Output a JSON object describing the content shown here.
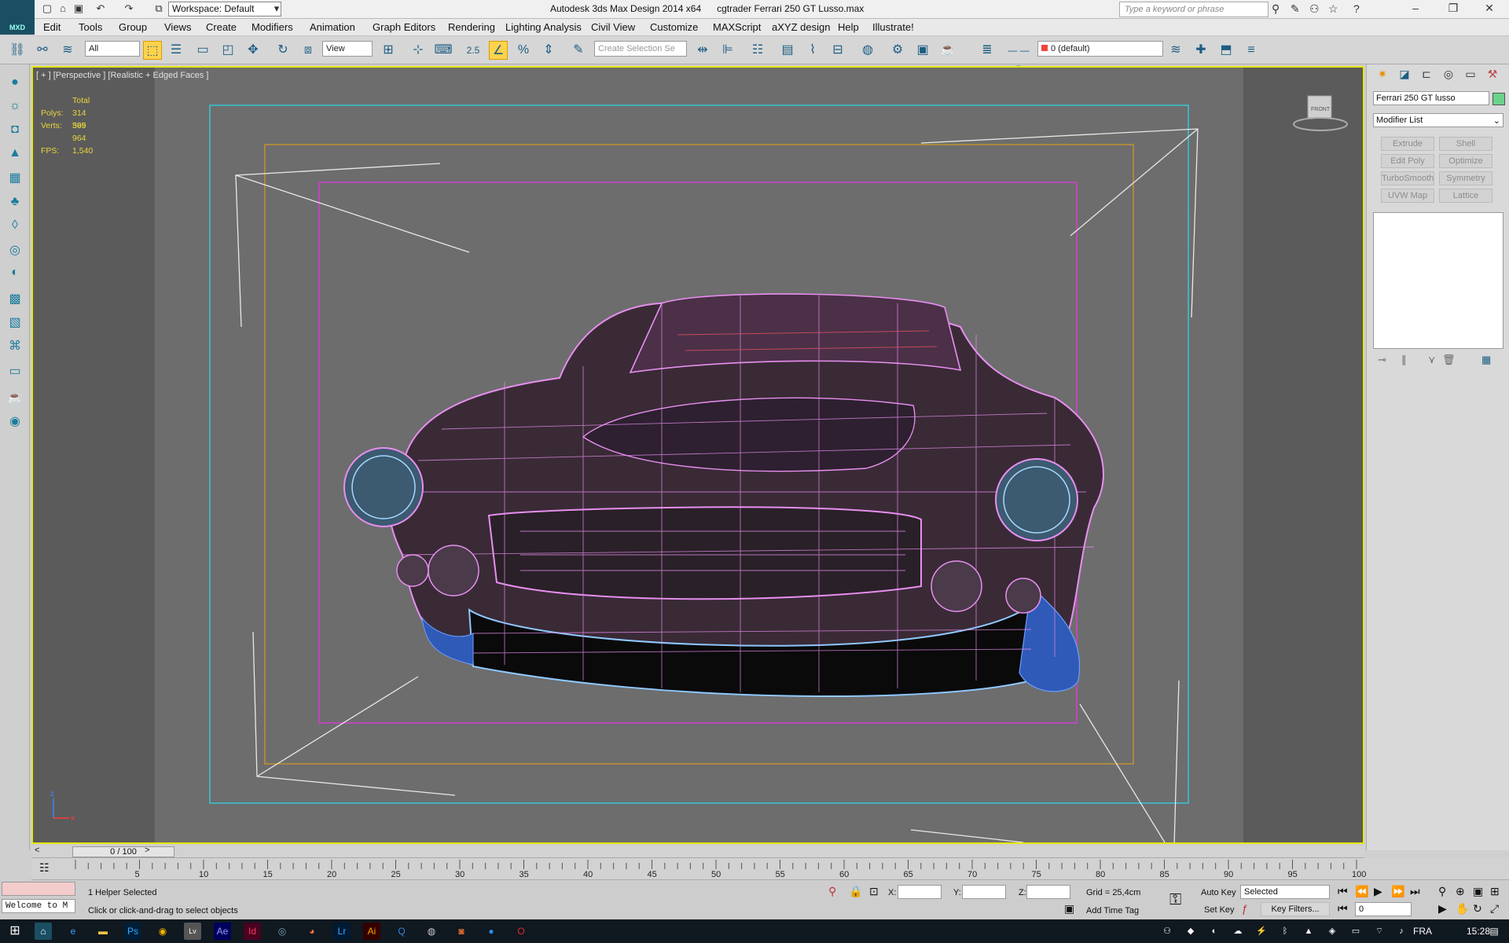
{
  "titlebar": {
    "app_title": "Autodesk 3ds Max Design 2014 x64      cgtrader Ferrari 250 GT Lusso.max",
    "logo_label": "MXD",
    "workspace": "Workspace: Default",
    "search_placeholder": "Type a keyword or phrase"
  },
  "menu": [
    "Edit",
    "Tools",
    "Group",
    "Views",
    "Create",
    "Modifiers",
    "Animation",
    "Graph Editors",
    "Rendering",
    "Lighting Analysis",
    "Civil View",
    "Customize",
    "MAXScript",
    "aXYZ design",
    "Help",
    "Illustrate!"
  ],
  "toolbar": {
    "selection_filter": "All",
    "ref_coord": "View",
    "snap_value": "2.5",
    "named_selection_placeholder": "Create Selection Se",
    "layer": "0 (default)"
  },
  "viewport": {
    "label": "[ + ] [Perspective ] [Realistic + Edged Faces ]",
    "stats": {
      "total_label": "Total",
      "polys_label": "Polys:",
      "polys_value": "314 599",
      "verts_label": "Verts:",
      "verts_value": "365 964",
      "fps_label": "FPS:",
      "fps_value": "1,540"
    },
    "viewcube_label": "FRONT"
  },
  "command_panel": {
    "object_name": "Ferrari 250 GT lusso",
    "modifier_list": "Modifier List",
    "buttons": [
      "Extrude",
      "Shell",
      "Edit Poly",
      "Optimize",
      "TurboSmooth",
      "Symmetry",
      "UVW Map",
      "Lattice"
    ]
  },
  "timeline": {
    "slider": "0 / 100",
    "ticks": [
      "5",
      "10",
      "15",
      "20",
      "25",
      "30",
      "35",
      "40",
      "45",
      "50",
      "55",
      "60",
      "65",
      "70",
      "75",
      "80",
      "85",
      "90",
      "95",
      "100"
    ]
  },
  "status": {
    "maxscript_listener": "Welcome to M",
    "selection": "1 Helper Selected",
    "prompt": "Click or click-and-drag to select objects",
    "x_label": "X:",
    "y_label": "Y:",
    "z_label": "Z:",
    "grid": "Grid = 25,4cm",
    "add_time_tag": "Add Time Tag",
    "auto_key": "Auto Key",
    "set_key": "Set Key",
    "selected": "Selected",
    "key_filters": "Key Filters...",
    "frame": "0"
  },
  "taskbar": {
    "apps": [
      "Ps",
      "Lv",
      "Ae",
      "Id",
      "Lr",
      "Ai"
    ],
    "language": "FRA",
    "clock": "15:28"
  }
}
